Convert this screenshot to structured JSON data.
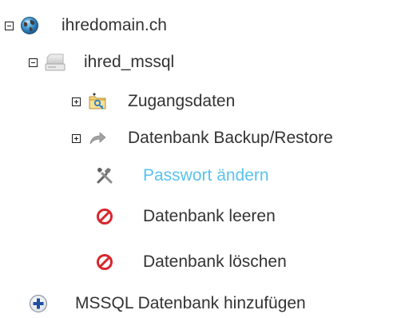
{
  "tree": {
    "domain": {
      "label": "ihredomain.ch",
      "icon": "globe-icon",
      "toggle": "collapse",
      "database": {
        "label": "ihred_mssql",
        "icon": "database-icon",
        "toggle": "collapse",
        "items": [
          {
            "label": "Zugangsdaten",
            "icon": "key-folder-icon",
            "toggle": "expand"
          },
          {
            "label": "Datenbank Backup/Restore",
            "icon": "arrow-forward-icon",
            "toggle": "expand"
          },
          {
            "label": "Passwort ändern",
            "icon": "tools-icon",
            "link_color": "#59c2ee"
          },
          {
            "label": "Datenbank leeren",
            "icon": "forbidden-icon"
          },
          {
            "label": "Datenbank löschen",
            "icon": "forbidden-icon"
          }
        ]
      }
    },
    "add_action": {
      "label": "MSSQL Datenbank hinzufügen",
      "icon": "add-circle-icon"
    }
  }
}
